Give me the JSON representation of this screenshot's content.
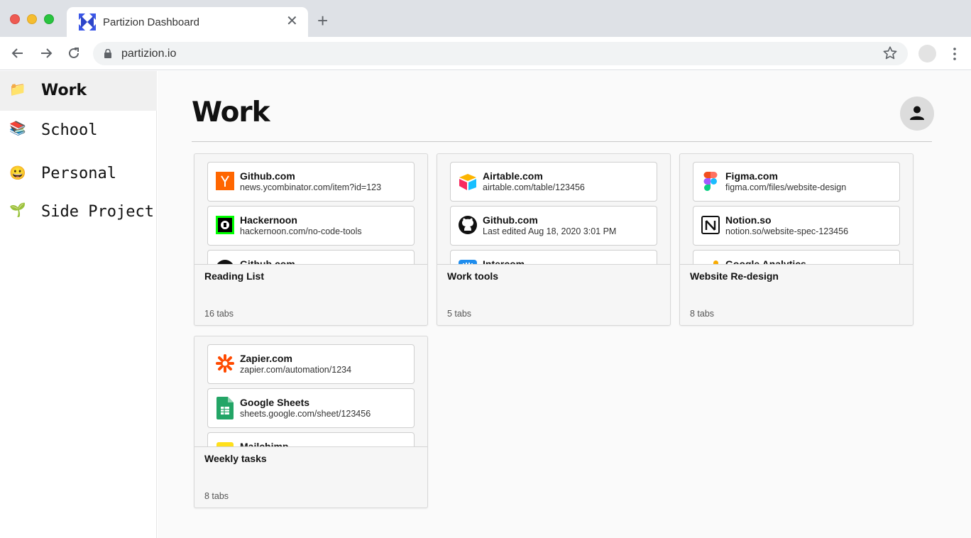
{
  "browser": {
    "tab_title": "Partizion Dashboard",
    "url": "partizion.io",
    "icons": {
      "favicon": "partizion-logo-icon",
      "close": "close-icon",
      "new_tab": "plus-icon",
      "back": "arrow-left-icon",
      "forward": "arrow-right-icon",
      "reload": "reload-icon",
      "lock": "lock-icon",
      "bookmark": "star-icon",
      "menu": "kebab-menu-icon"
    }
  },
  "sidebar": {
    "items": [
      {
        "emoji": "📁",
        "label": "Work",
        "active": true
      },
      {
        "emoji": "📚",
        "label": "School",
        "active": false
      },
      {
        "emoji": "😀",
        "label": "Personal",
        "active": false
      },
      {
        "emoji": "🌱",
        "label": "Side Project",
        "active": false
      }
    ]
  },
  "main": {
    "title": "Work",
    "groups": [
      {
        "name": "Reading List",
        "count": "16 tabs",
        "tabs": [
          {
            "icon": "ycombinator-icon",
            "title": "Github.com",
            "url": "news.ycombinator.com/item?id=123"
          },
          {
            "icon": "hackernoon-icon",
            "title": "Hackernoon",
            "url": "hackernoon.com/no-code-tools"
          },
          {
            "icon": "github-icon",
            "title": "Github.com",
            "url": ""
          }
        ]
      },
      {
        "name": "Work tools",
        "count": "5 tabs",
        "tabs": [
          {
            "icon": "airtable-icon",
            "title": "Airtable.com",
            "url": "airtable.com/table/123456"
          },
          {
            "icon": "github-icon",
            "title": "Github.com",
            "url": "Last edited Aug 18, 2020 3:01 PM"
          },
          {
            "icon": "intercom-icon",
            "title": "Intercom",
            "url": ""
          }
        ]
      },
      {
        "name": "Website Re-design",
        "count": "8 tabs",
        "tabs": [
          {
            "icon": "figma-icon",
            "title": "Figma.com",
            "url": "figma.com/files/website-design"
          },
          {
            "icon": "notion-icon",
            "title": "Notion.so",
            "url": "notion.so/website-spec-123456"
          },
          {
            "icon": "google-analytics-icon",
            "title": "Google Analytics",
            "url": ""
          }
        ]
      },
      {
        "name": "Weekly tasks",
        "count": "8 tabs",
        "tabs": [
          {
            "icon": "zapier-icon",
            "title": "Zapier.com",
            "url": "zapier.com/automation/1234"
          },
          {
            "icon": "google-sheets-icon",
            "title": "Google Sheets",
            "url": "sheets.google.com/sheet/123456"
          },
          {
            "icon": "mailchimp-icon",
            "title": "Mailchimp",
            "url": ""
          }
        ]
      }
    ]
  },
  "colors": {
    "tabstrip": "#dee1e6",
    "sidebar_active": "#f0f0f0",
    "main_bg": "#fafafa",
    "card_border": "#cfcfcf"
  }
}
